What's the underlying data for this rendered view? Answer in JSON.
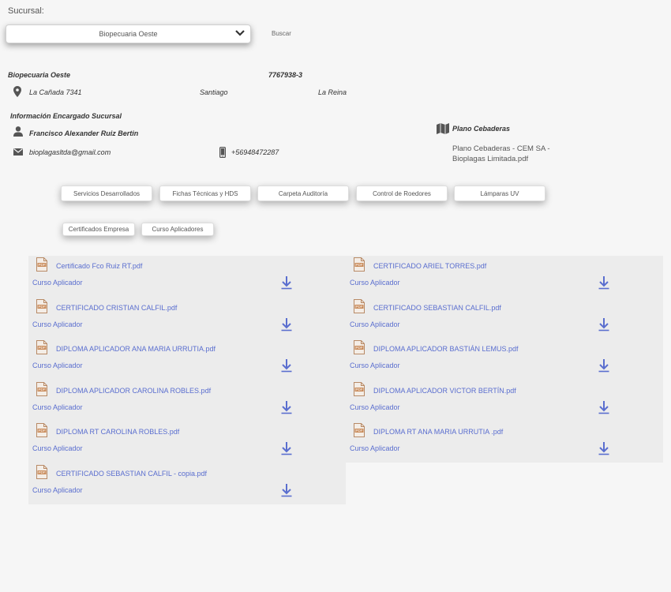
{
  "branch_label": "Sucursal:",
  "branch_select": {
    "value": "Biopecuaria Oeste"
  },
  "search_label": "Buscar",
  "branch_info": {
    "name": "Biopecuaria Oeste",
    "rut": "7767938-3",
    "address": "La Cañada 7341",
    "city": "Santiago",
    "commune": "La Reina"
  },
  "manager": {
    "section_title": "Información Encargado Sucursal",
    "name": "Francisco Alexander Ruiz Bertin",
    "email": "bioplagasltda@gmail.com",
    "phone": "+56948472287"
  },
  "plan": {
    "title": "Plano Cebaderas",
    "file": "Plano Cebaderas - CEM SA - Bioplagas Limitada.pdf"
  },
  "tabs_row1": [
    "Servicios Desarrollados",
    "Fichas Técnicas y HDS",
    "Carpeta Auditoría",
    "Control de Roedores",
    "Lámparas UV"
  ],
  "tabs_row2": [
    "Certificados Empresa",
    "Curso Aplicadores"
  ],
  "files_left": [
    {
      "name": "Certificado Fco Ruiz RT.pdf",
      "category": "Curso Aplicador"
    },
    {
      "name": "CERTIFICADO CRISTIAN CALFIL.pdf",
      "category": "Curso Aplicador"
    },
    {
      "name": "DIPLOMA APLICADOR ANA MARIA URRUTIA.pdf",
      "category": "Curso Aplicador"
    },
    {
      "name": "DIPLOMA APLICADOR CAROLINA ROBLES.pdf",
      "category": "Curso Aplicador"
    },
    {
      "name": "DIPLOMA RT CAROLINA ROBLES.pdf",
      "category": "Curso Aplicador"
    },
    {
      "name": "CERTIFICADO SEBASTIAN CALFIL - copia.pdf",
      "category": "Curso Aplicador"
    }
  ],
  "files_right": [
    {
      "name": "CERTIFICADO ARIEL TORRES.pdf",
      "category": "Curso Aplicador"
    },
    {
      "name": "CERTIFICADO SEBASTIAN CALFIL.pdf",
      "category": "Curso Aplicador"
    },
    {
      "name": "DIPLOMA APLICADOR BASTIÁN LEMUS.pdf",
      "category": "Curso Aplicador"
    },
    {
      "name": "DIPLOMA APLICADOR VICTOR BERTÍN.pdf",
      "category": "Curso Aplicador"
    },
    {
      "name": "DIPLOMA RT ANA MARIA URRUTIA .pdf",
      "category": "Curso Aplicador"
    }
  ],
  "colors": {
    "link": "#5a6ecf",
    "panel": "#ececec",
    "icon": "#555555",
    "pdf_icon": "#c98b5a"
  },
  "icons": {
    "location": "map-pin-icon",
    "person": "person-icon",
    "mail": "mail-icon",
    "phone": "phone-icon",
    "map": "map-icon",
    "pdf": "pdf-file-icon",
    "download": "download-icon",
    "dropdown": "chevron-down-icon"
  }
}
